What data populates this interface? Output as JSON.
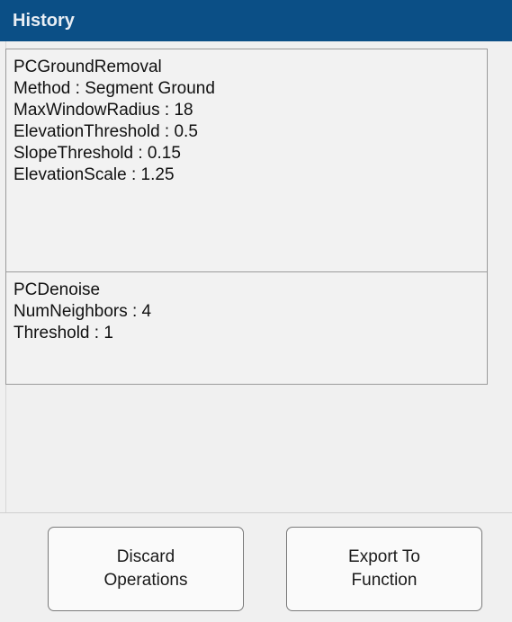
{
  "header": {
    "title": "History"
  },
  "history": {
    "items": [
      {
        "name": "PCGroundRemoval",
        "params": [
          "Method : Segment Ground",
          "MaxWindowRadius : 18",
          "ElevationThreshold : 0.5",
          "SlopeThreshold : 0.15",
          "ElevationScale : 1.25"
        ]
      },
      {
        "name": "PCDenoise",
        "params": [
          "NumNeighbors : 4",
          "Threshold : 1"
        ]
      }
    ]
  },
  "buttons": {
    "discard_label": "Discard\nOperations",
    "export_label": "Export To\nFunction"
  },
  "colors": {
    "header_bg": "#0b4f86",
    "panel_bg": "#f0f0f0"
  }
}
